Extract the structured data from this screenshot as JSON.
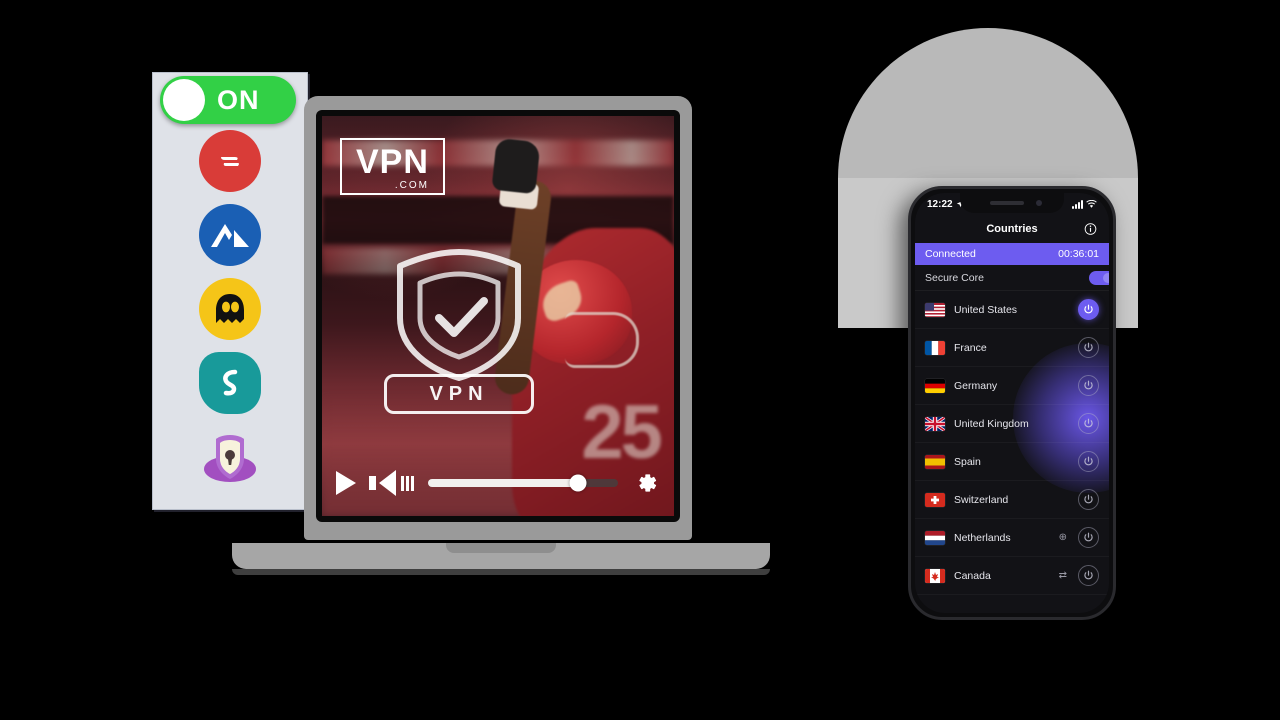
{
  "providers": {
    "toggle": {
      "label": "ON",
      "state": "on",
      "color": "#32d046"
    },
    "items": [
      {
        "name": "ExpressVPN",
        "icon": "expressvpn-logo",
        "color": "#d93c38"
      },
      {
        "name": "NordVPN",
        "icon": "nordvpn-logo",
        "color": "#1a5fb4"
      },
      {
        "name": "CyberGhost VPN",
        "icon": "cyberghost-logo",
        "color": "#f5c518"
      },
      {
        "name": "Surfshark",
        "icon": "surfshark-logo",
        "color": "#189a9a"
      },
      {
        "name": "Proton VPN",
        "icon": "protonvpn-logo",
        "color": "#9b4fc0"
      }
    ]
  },
  "laptop": {
    "video": {
      "brand": {
        "main": "VPN",
        "sub": ".COM"
      },
      "watermark_label": "VPN",
      "scene_description": "football player celebrating",
      "jersey_number": "25",
      "play_overlay_icon": "play-icon"
    },
    "controls": {
      "play_icon": "play-icon",
      "volume_icon": "volume-icon",
      "settings_icon": "gear-icon",
      "progress_percent": 79
    }
  },
  "phone": {
    "status": {
      "time": "12:22",
      "location_icon": "location-arrow-icon",
      "signal_icon": "signal-bars-icon",
      "wifi_icon": "wifi-icon"
    },
    "header": {
      "title": "Countries",
      "info_icon": "info-circle-icon"
    },
    "connection": {
      "status": "Connected",
      "duration": "00:36:01",
      "accent": "#6d5cf0"
    },
    "secure_core": {
      "label": "Secure Core",
      "enabled": true
    },
    "countries": [
      {
        "name": "United States",
        "flag": "us",
        "active": true,
        "extra_icon": ""
      },
      {
        "name": "France",
        "flag": "fr",
        "active": false,
        "extra_icon": ""
      },
      {
        "name": "Germany",
        "flag": "de",
        "active": false,
        "extra_icon": ""
      },
      {
        "name": "United Kingdom",
        "flag": "gb",
        "active": false,
        "extra_icon": ""
      },
      {
        "name": "Spain",
        "flag": "es",
        "active": false,
        "extra_icon": ""
      },
      {
        "name": "Switzerland",
        "flag": "ch",
        "active": false,
        "extra_icon": ""
      },
      {
        "name": "Netherlands",
        "flag": "nl",
        "active": false,
        "extra_icon": "⊕"
      },
      {
        "name": "Canada",
        "flag": "ca",
        "active": false,
        "extra_icon": "⇄"
      }
    ]
  }
}
